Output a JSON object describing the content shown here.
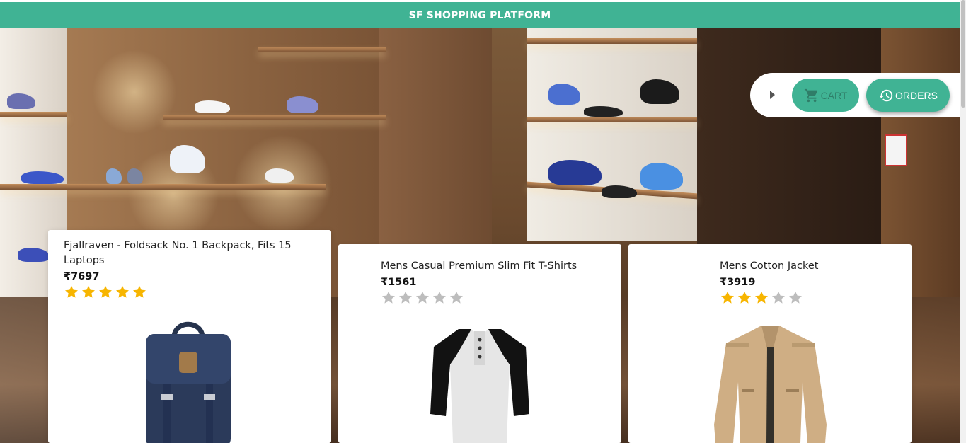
{
  "header": {
    "title": "SF SHOPPING PLATFORM"
  },
  "nav": {
    "cart_label": "CART",
    "orders_label": "ORDERS",
    "cart_icon": "shopping-cart-icon",
    "orders_icon": "history-icon",
    "expand_icon": "caret-right-icon"
  },
  "colors": {
    "accent": "#40b394",
    "star_filled": "#f7b500",
    "star_empty": "#bdbdbd"
  },
  "products": [
    {
      "title": "Fjallraven - Foldsack No. 1 Backpack, Fits 15 Laptops",
      "price": "₹7697",
      "rating": 5,
      "max_rating": 5
    },
    {
      "title": "Mens Casual Premium Slim Fit T-Shirts",
      "price": "₹1561",
      "rating": 0,
      "max_rating": 5
    },
    {
      "title": "Mens Cotton Jacket",
      "price": "₹3919",
      "rating": 3,
      "max_rating": 5
    }
  ]
}
